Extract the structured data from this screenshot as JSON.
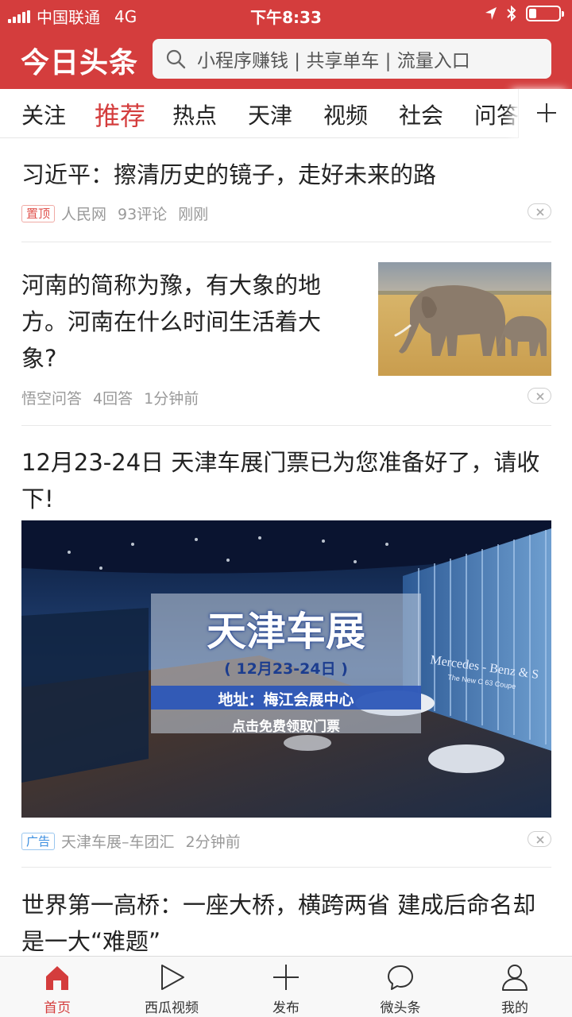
{
  "status_bar": {
    "carrier": "中国联通",
    "network": "4G",
    "time": "下午8:33",
    "icons": [
      "signal-bars",
      "location-arrow",
      "bluetooth",
      "battery-low"
    ]
  },
  "header": {
    "logo": "今日头条",
    "search_placeholder": "小程序赚钱 | 共享单车 | 流量入口"
  },
  "channels": {
    "active": "推荐",
    "items": [
      "关注",
      "推荐",
      "热点",
      "天津",
      "视频",
      "社会",
      "问答"
    ]
  },
  "feed": [
    {
      "title": "习近平：擦清历史的镜子，走好未来的路",
      "badge": "置顶",
      "source": "人民网",
      "comments": "93评论",
      "time": "刚刚"
    },
    {
      "title": "河南的简称为豫，有大象的地方。河南在什么时间生活着大象?",
      "source": "悟空问答",
      "answers": "4回答",
      "time": "1分钟前",
      "image": "elephants-savanna"
    },
    {
      "title": "12月23-24日 天津车展门票已为您准备好了，请收下!",
      "banner": {
        "headline": "天津车展",
        "dates": "( 12月23-24日 )",
        "address": "地址：梅江会展中心",
        "cta": "点击免费领取门票",
        "brand_sign": "Mercedes - Benz & S",
        "model_sign": "The New C 63 Coupe"
      },
      "badge": "广告",
      "source": "天津车展–车团汇",
      "time": "2分钟前"
    },
    {
      "title": "世界第一高桥：一座大桥，横跨两省 建成后命名却是一大“难题”"
    }
  ],
  "tabbar": {
    "active": "首页",
    "items": [
      {
        "label": "首页",
        "icon": "home-icon"
      },
      {
        "label": "西瓜视频",
        "icon": "play-icon"
      },
      {
        "label": "发布",
        "icon": "plus-icon"
      },
      {
        "label": "微头条",
        "icon": "chat-bubble-icon"
      },
      {
        "label": "我的",
        "icon": "user-icon"
      }
    ]
  },
  "colors": {
    "brand_red": "#d43d3d",
    "badge_top": "#e0544f",
    "badge_ad": "#3a8ee0",
    "meta_gray": "#999999"
  }
}
